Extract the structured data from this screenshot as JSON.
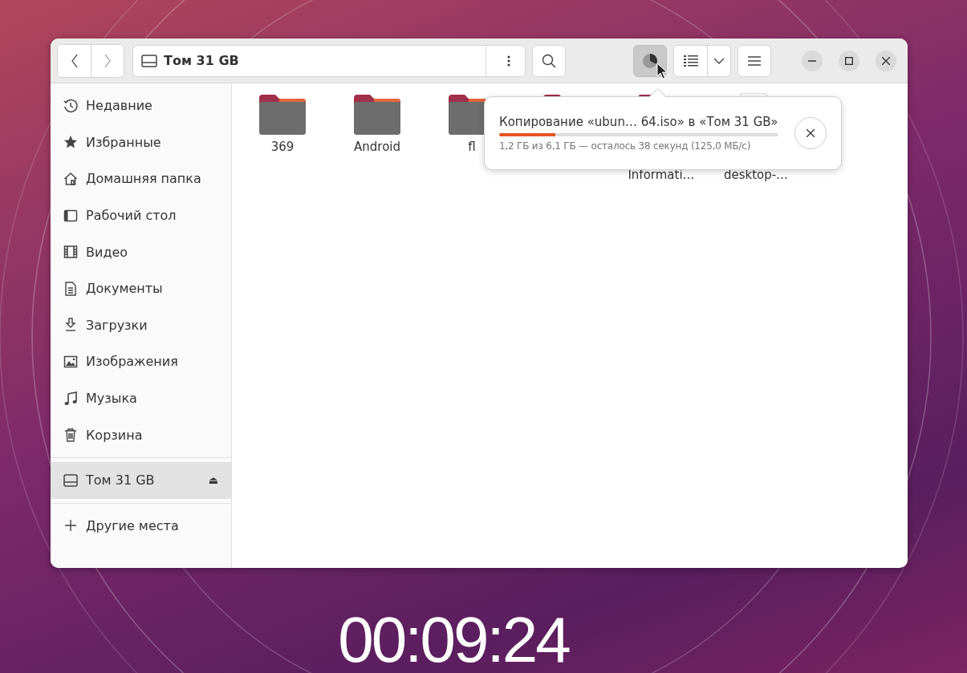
{
  "location": {
    "label": "Том 31 GB"
  },
  "sidebar": {
    "places": [
      {
        "kind": "clock",
        "label": "Недавние",
        "selected": false
      },
      {
        "kind": "star",
        "label": "Избранные",
        "selected": false
      },
      {
        "kind": "home",
        "label": "Домашняя папка",
        "selected": false
      },
      {
        "kind": "desktop",
        "label": "Рабочий стол",
        "selected": false
      },
      {
        "kind": "film",
        "label": "Видео",
        "selected": false
      },
      {
        "kind": "document",
        "label": "Документы",
        "selected": false
      },
      {
        "kind": "download",
        "label": "Загрузки",
        "selected": false
      },
      {
        "kind": "image",
        "label": "Изображения",
        "selected": false
      },
      {
        "kind": "music",
        "label": "Музыка",
        "selected": false
      },
      {
        "kind": "trash",
        "label": "Корзина",
        "selected": false
      }
    ],
    "devices": [
      {
        "kind": "drive",
        "label": "Том 31 GB",
        "selected": true,
        "eject": "⏏"
      }
    ],
    "other": {
      "label": "Другие места"
    }
  },
  "files": [
    {
      "kind": "folder",
      "name": "369"
    },
    {
      "kind": "folder",
      "name": "Android"
    },
    {
      "kind": "folder",
      "name": "fl"
    },
    {
      "kind": "folder"
    },
    {
      "kind": "folder",
      "name": "Informati…"
    },
    {
      "kind": "file",
      "name": "desktop-…"
    }
  ],
  "operation": {
    "title": "Копирование «ubun…  64.iso» в «Том 31 GB»",
    "level": 0.2,
    "details": "1,2 ГБ из 6,1 ГБ — осталось 38 секунд (125,0 МБ/с)"
  },
  "timer": "00:09:24"
}
